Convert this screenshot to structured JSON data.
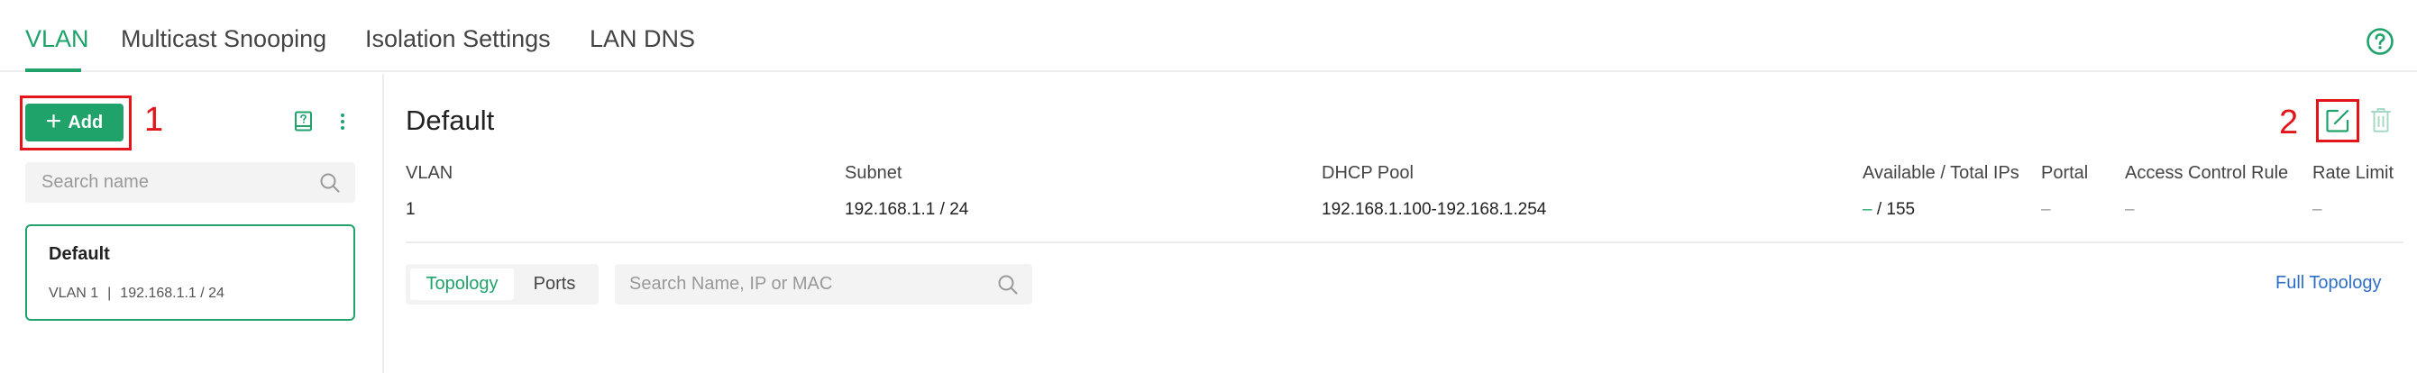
{
  "tabs": [
    {
      "label": "VLAN",
      "active": true
    },
    {
      "label": "Multicast Snooping",
      "active": false
    },
    {
      "label": "Isolation Settings",
      "active": false
    },
    {
      "label": "LAN DNS",
      "active": false
    }
  ],
  "left": {
    "add_label": "Add",
    "annotation_1": "1",
    "search_placeholder": "Search name",
    "vlans": [
      {
        "name": "Default",
        "vlan": "VLAN 1",
        "subnet": "192.168.1.1 / 24"
      }
    ]
  },
  "detail": {
    "title": "Default",
    "annotation_2": "2",
    "columns": [
      "VLAN",
      "Subnet",
      "DHCP Pool",
      "Available / Total IPs",
      "Portal",
      "Access Control Rule",
      "Rate Limit"
    ],
    "values": {
      "vlan": "1",
      "subnet": "192.168.1.1 / 24",
      "dhcp_pool": "192.168.1.100-192.168.1.254",
      "available": "–",
      "total": " / 155",
      "portal": "–",
      "acl": "–",
      "rate_limit": "–"
    },
    "view_tabs": [
      {
        "label": "Topology",
        "active": true
      },
      {
        "label": "Ports",
        "active": false
      }
    ],
    "client_search_placeholder": "Search Name, IP or MAC",
    "full_topology_label": "Full Topology"
  },
  "colors": {
    "accent": "#1fa36b",
    "annotation": "#e3151b",
    "link": "#2e6fc4"
  },
  "icons": [
    "plus-icon",
    "help-icon",
    "book-icon",
    "more-icon",
    "search-icon",
    "edit-icon",
    "delete-icon"
  ]
}
